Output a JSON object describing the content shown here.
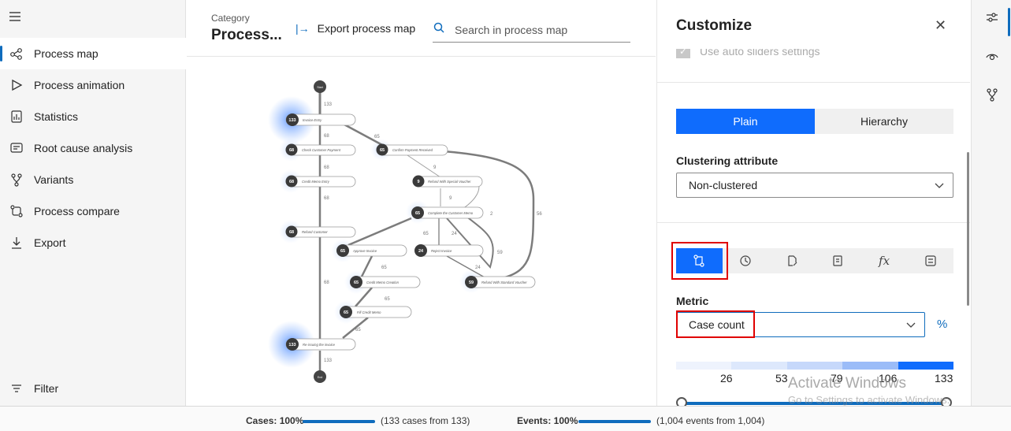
{
  "sidebar": {
    "items": [
      {
        "label": "Process map",
        "icon": "process-map-icon",
        "active": true
      },
      {
        "label": "Process animation",
        "icon": "play-icon"
      },
      {
        "label": "Statistics",
        "icon": "statistics-icon"
      },
      {
        "label": "Root cause analysis",
        "icon": "root-cause-icon"
      },
      {
        "label": "Variants",
        "icon": "variants-icon"
      },
      {
        "label": "Process compare",
        "icon": "compare-icon"
      },
      {
        "label": "Export",
        "icon": "download-icon"
      }
    ],
    "filter_label": "Filter"
  },
  "header": {
    "category_label": "Category",
    "category_value": "Process...",
    "export_label": "Export process map",
    "search_placeholder": "Search in process map"
  },
  "map": {
    "start_label": "Start",
    "end_label": "End",
    "nodes": [
      {
        "count": "133",
        "label": "Invoice Entry"
      },
      {
        "count": "68",
        "label": "Check Customer Payment"
      },
      {
        "count": "65",
        "label": "Confirm Payment Received"
      },
      {
        "count": "68",
        "label": "Credit Memo Entry"
      },
      {
        "count": "9",
        "label": "Refund With Special Voucher"
      },
      {
        "count": "65",
        "label": "Complete the Customer Memo"
      },
      {
        "count": "68",
        "label": "Refund Customer"
      },
      {
        "count": "65",
        "label": "Approve Invoice"
      },
      {
        "count": "24",
        "label": "Reject Invoice"
      },
      {
        "count": "65",
        "label": "Credit Memo Creation"
      },
      {
        "count": "59",
        "label": "Refund With Standard Voucher"
      },
      {
        "count": "65",
        "label": "Fill Credit Memo"
      },
      {
        "count": "133",
        "label": "Re-issuing the invoice"
      }
    ],
    "edges": [
      "133",
      "68",
      "65",
      "68",
      "9",
      "68",
      "9",
      "2",
      "56",
      "65",
      "24",
      "59",
      "65",
      "24",
      "65",
      "65",
      "68",
      "65",
      "133"
    ]
  },
  "customize": {
    "title": "Customize",
    "auto_sliders_label": "Use auto sliders settings",
    "mode_plain": "Plain",
    "mode_hierarchy": "Hierarchy",
    "clustering_label": "Clustering attribute",
    "clustering_value": "Non-clustered",
    "metric_label": "Metric",
    "metric_value": "Case count",
    "percent_label": "%",
    "metric_icons": [
      "case-count-icon",
      "clock-icon",
      "document-edit-icon",
      "report-icon",
      "function-icon",
      "checklist-icon"
    ],
    "scale_values": [
      "26",
      "53",
      "79",
      "106",
      "133"
    ],
    "scale_colors": [
      "#eef3fd",
      "#dde8fc",
      "#c6d8fb",
      "#9bbcf8",
      "#0f6cfd"
    ],
    "watermark_title": "Activate Windows",
    "watermark_sub": "Go to Settings to activate Windows."
  },
  "rail": {
    "items": [
      "sliders-icon",
      "eye-icon",
      "variants-rail-icon"
    ]
  },
  "status": {
    "cases_label": "Cases: 100%",
    "cases_text": "(133 cases from 133)",
    "events_label": "Events: 100%",
    "events_text": "(1,004 events from 1,004)"
  }
}
